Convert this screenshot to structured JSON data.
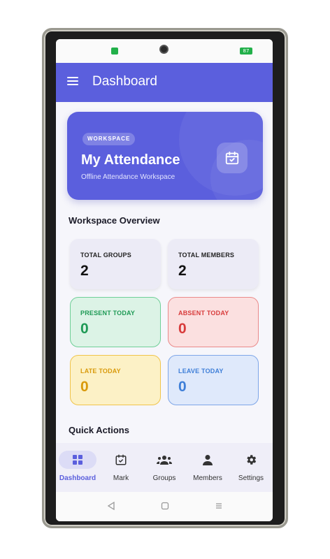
{
  "status_bar": {
    "battery": "87"
  },
  "app_bar": {
    "title": "Dashboard",
    "menu_icon": "menu-icon"
  },
  "workspace_card": {
    "badge": "WORKSPACE",
    "title": "My Attendance",
    "subtitle": "Offline Attendance Workspace",
    "icon": "calendar-check-icon"
  },
  "overview": {
    "title": "Workspace Overview",
    "stats": [
      {
        "label": "TOTAL GROUPS",
        "value": "2",
        "color": "#1b1b28"
      },
      {
        "label": "TOTAL MEMBERS",
        "value": "2",
        "color": "#1b1b28"
      },
      {
        "label": "PRESENT TODAY",
        "value": "0",
        "color": "#1e9a55"
      },
      {
        "label": "ABSENT TODAY",
        "value": "0",
        "color": "#d83b3b"
      },
      {
        "label": "LATE TODAY",
        "value": "0",
        "color": "#d99a0b"
      },
      {
        "label": "LEAVE TODAY",
        "value": "0",
        "color": "#3f7fd8"
      }
    ]
  },
  "quick_actions": {
    "title": "Quick Actions"
  },
  "bottom_nav": {
    "items": [
      {
        "label": "Dashboard",
        "icon": "grid-icon",
        "active": true
      },
      {
        "label": "Mark",
        "icon": "calendar-check-icon",
        "active": false
      },
      {
        "label": "Groups",
        "icon": "groups-icon",
        "active": false
      },
      {
        "label": "Members",
        "icon": "person-icon",
        "active": false
      },
      {
        "label": "Settings",
        "icon": "gear-icon",
        "active": false
      }
    ]
  },
  "system_nav": {
    "icons": [
      "back-icon",
      "home-icon",
      "recents-icon"
    ]
  },
  "colors": {
    "primary": "#5b5fdd",
    "background": "#f6f6fb"
  }
}
